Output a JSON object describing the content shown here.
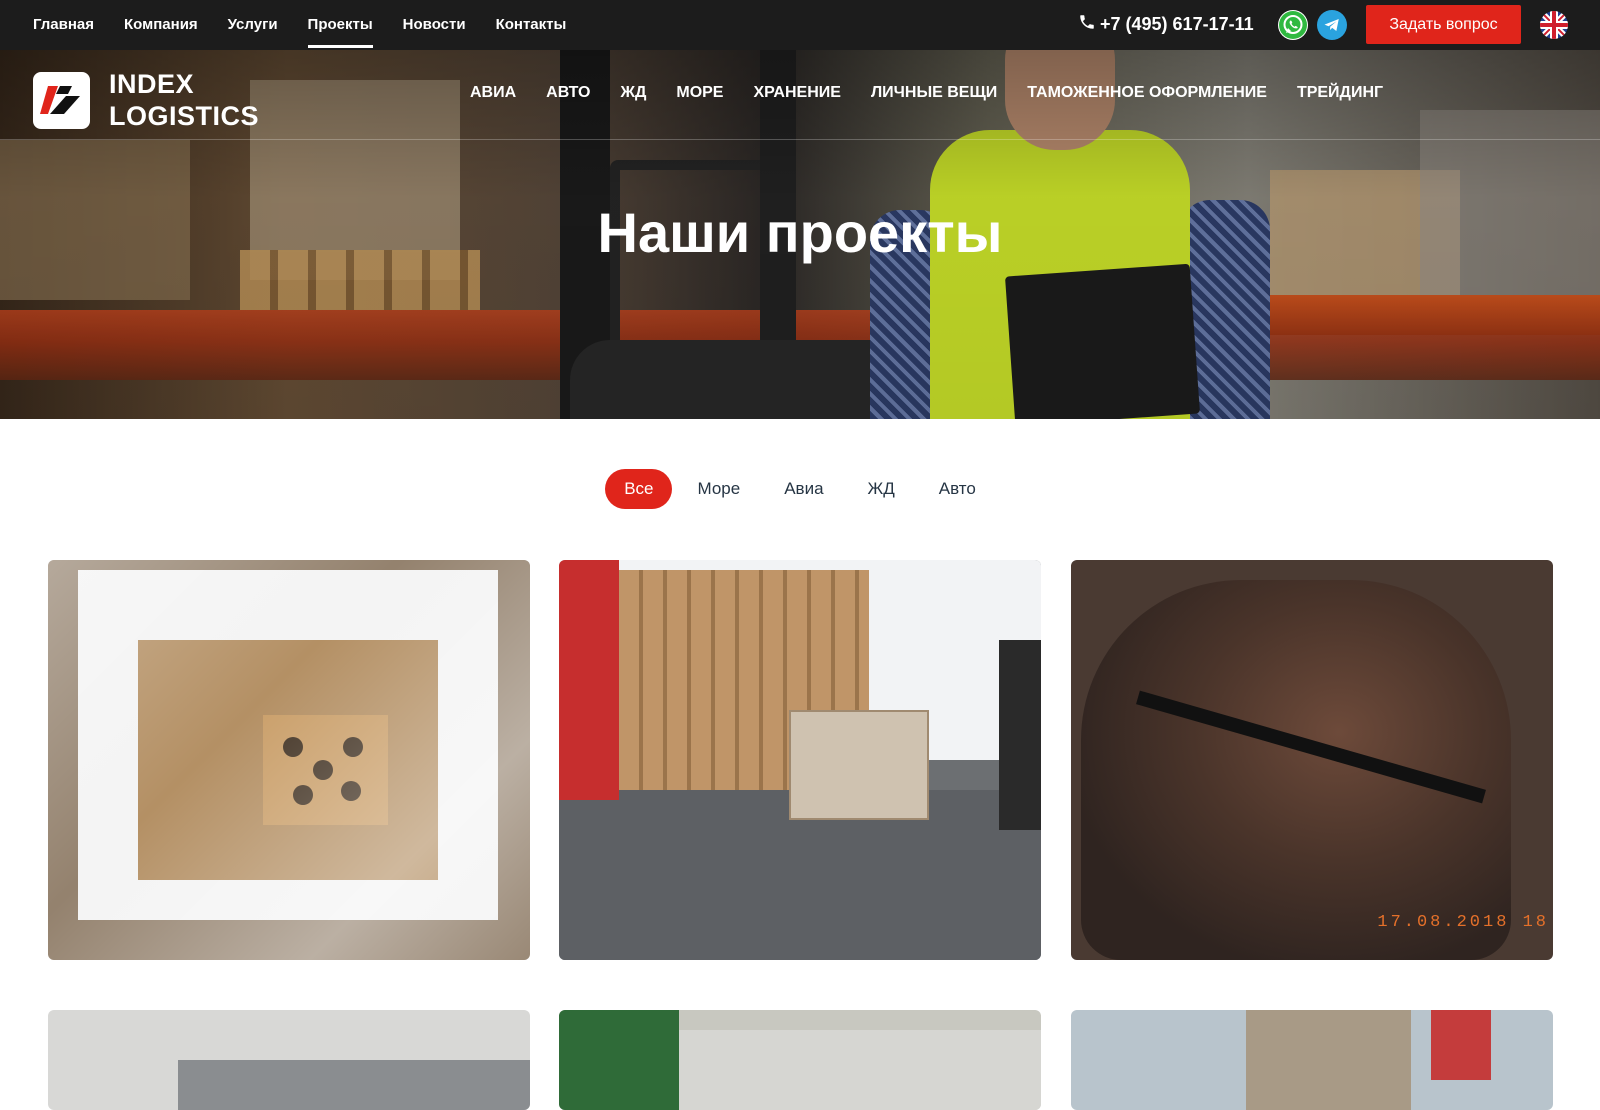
{
  "topbar": {
    "nav": [
      "Главная",
      "Компания",
      "Услуги",
      "Проекты",
      "Новости",
      "Контакты"
    ],
    "active_nav": "Проекты",
    "phone": "+7 (495) 617-17-11",
    "ask_button": "Задать вопрос",
    "icons": {
      "phone": "phone-icon",
      "whatsapp": "whatsapp-icon",
      "telegram": "telegram-icon",
      "language": "uk-flag-icon"
    }
  },
  "header": {
    "logo_line1": "INDEX",
    "logo_line2": "LOGISTICS",
    "services": [
      "АВИА",
      "АВТО",
      "ЖД",
      "МОРЕ",
      "ХРАНЕНИЕ",
      "ЛИЧНЫЕ ВЕЩИ",
      "ТАМОЖЕННОЕ ОФОРМЛЕНИЕ",
      "ТРЕЙДИНГ"
    ]
  },
  "hero": {
    "title": "Наши проекты"
  },
  "filters": {
    "items": [
      "Все",
      "Море",
      "Авиа",
      "ЖД",
      "Авто"
    ],
    "active": "Все"
  },
  "projects": {
    "photo3_timestamp": "17.08.2018 18"
  },
  "colors": {
    "accent": "#e0251b",
    "topbar_bg": "#1c1c1c",
    "text_dark": "#263544"
  }
}
